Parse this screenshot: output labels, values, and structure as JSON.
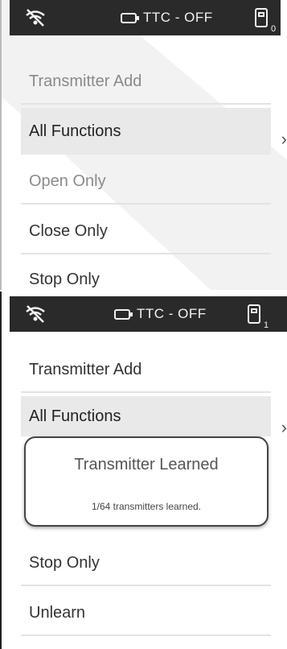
{
  "screens": [
    {
      "status": {
        "ttc_label": "TTC - OFF",
        "transmitter_count": "0"
      },
      "menu": [
        {
          "label": "Transmitter Add"
        },
        {
          "label": "All Functions"
        },
        {
          "label": "Open Only"
        },
        {
          "label": "Close Only"
        },
        {
          "label": "Stop Only"
        }
      ],
      "chevron": "›"
    },
    {
      "status": {
        "ttc_label": "TTC - OFF",
        "transmitter_count": "1"
      },
      "menu": [
        {
          "label": "Transmitter Add"
        },
        {
          "label": "All Functions"
        },
        {
          "label": "Stop Only"
        },
        {
          "label": "Unlearn"
        }
      ],
      "chevron": "›",
      "popup": {
        "title": "Transmitter Learned",
        "message": "1/64 transmitters learned."
      }
    }
  ],
  "icons": [
    "wifi-off-icon",
    "battery-charging-icon",
    "remote-icon",
    "chevron-right-icon"
  ]
}
